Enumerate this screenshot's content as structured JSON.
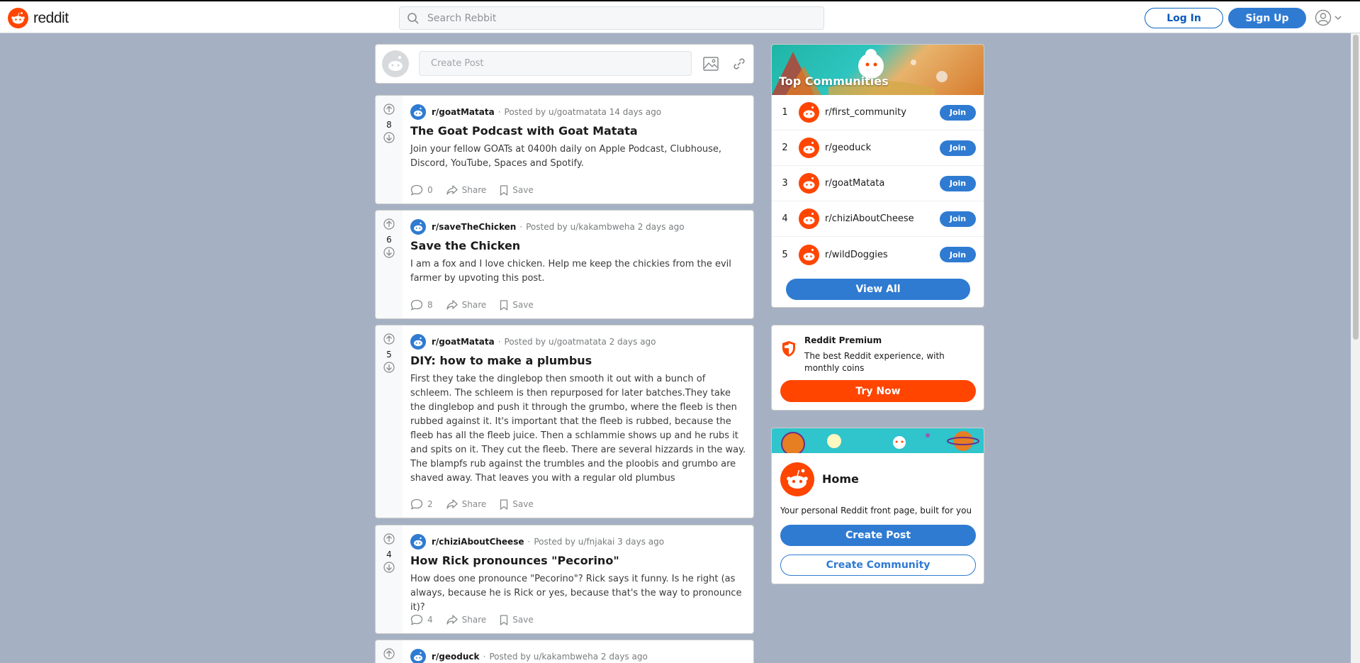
{
  "header": {
    "logo_text": "reddit",
    "search_placeholder": "Search Rebbit",
    "login_label": "Log In",
    "signup_label": "Sign Up"
  },
  "create_post": {
    "placeholder": "Create Post"
  },
  "posts": [
    {
      "votes": "8",
      "subreddit": "r/goatMatata",
      "meta": "Posted by u/goatmatata 14 days ago",
      "title": "The Goat Podcast with Goat Matata",
      "body": "Join your fellow GOATs at 0400h daily on Apple Podcast, Clubhouse, Discord, YouTube, Spaces and Spotify.",
      "comments": "0",
      "share_label": "Share",
      "save_label": "Save"
    },
    {
      "votes": "6",
      "subreddit": "r/saveTheChicken",
      "meta": "Posted by u/kakambweha 2 days ago",
      "title": "Save the Chicken",
      "body": "I am a fox and I love chicken. Help me keep the chickies from the evil farmer by upvoting this post.",
      "comments": "8",
      "share_label": "Share",
      "save_label": "Save"
    },
    {
      "votes": "5",
      "subreddit": "r/goatMatata",
      "meta": "Posted by u/goatmatata 2 days ago",
      "title": "DIY: how to make a plumbus",
      "body": "First they take the dinglebop then smooth it out with a bunch of schleem. The schleem is then repurposed for later batches.They take the dinglebop and push it through the grumbo, where the fleeb is then rubbed against it. It's important that the fleeb is rubbed, because the fleeb has all the fleeb juice. Then a schlammie shows up and he rubs it and spits on it. They cut the fleeb. There are several hizzards in the way. The blampfs rub against the trumbles and the ploobis and grumbo are shaved away. That leaves you with a regular old plumbus",
      "comments": "2",
      "share_label": "Share",
      "save_label": "Save"
    },
    {
      "votes": "4",
      "subreddit": "r/chiziAboutCheese",
      "meta": "Posted by u/fnjakai 3 days ago",
      "title": "How Rick pronounces \"Pecorino\"",
      "body": "How does one pronounce \"Pecorino\"? Rick says it funny. Is he right (as always, because he is Rick or yes, because that's the way to pronounce it)?",
      "comments": "4",
      "share_label": "Share",
      "save_label": "Save"
    },
    {
      "subreddit": "r/geoduck",
      "meta": "Posted by u/kakambweha 2 days ago"
    }
  ],
  "top_communities": {
    "title": "Top Communities",
    "items": [
      {
        "rank": "1",
        "name": "r/first_community",
        "join_label": "Join"
      },
      {
        "rank": "2",
        "name": "r/geoduck",
        "join_label": "Join"
      },
      {
        "rank": "3",
        "name": "r/goatMatata",
        "join_label": "Join"
      },
      {
        "rank": "4",
        "name": "r/chiziAboutCheese",
        "join_label": "Join"
      },
      {
        "rank": "5",
        "name": "r/wildDoggies",
        "join_label": "Join"
      }
    ],
    "view_all_label": "View All"
  },
  "premium": {
    "title": "Reddit Premium",
    "description": "The best Reddit experience, with monthly coins",
    "button_label": "Try Now"
  },
  "home": {
    "title": "Home",
    "description": "Your personal Reddit front page, built for you",
    "create_post_label": "Create Post",
    "create_community_label": "Create Community"
  },
  "colors": {
    "brand_orange": "#ff4500",
    "accent_blue": "#2f7bd2",
    "page_background": "#a5b1c2"
  },
  "icons": [
    "reddit-logo-icon",
    "search-icon",
    "user-icon",
    "chevron-down-icon",
    "image-icon",
    "link-icon",
    "upvote-icon",
    "downvote-icon",
    "comment-icon",
    "share-icon",
    "save-icon",
    "shield-icon"
  ]
}
